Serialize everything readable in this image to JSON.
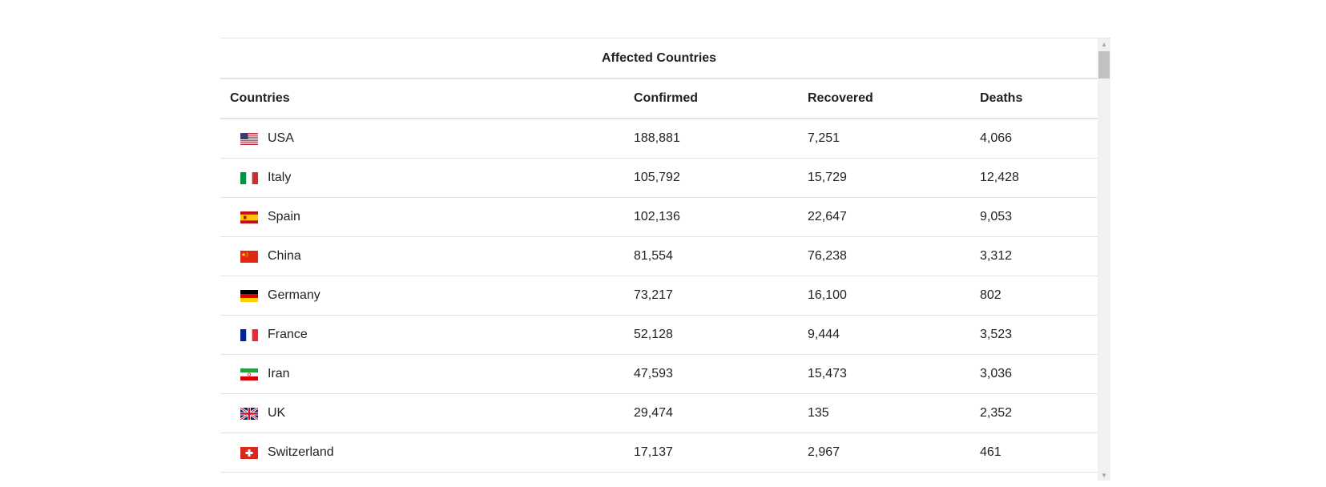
{
  "table": {
    "title": "Affected Countries",
    "headers": {
      "country": "Countries",
      "confirmed": "Confirmed",
      "recovered": "Recovered",
      "deaths": "Deaths"
    },
    "rows": [
      {
        "country": "USA",
        "flag": "us-flag-icon",
        "confirmed": "188,881",
        "recovered": "7,251",
        "deaths": "4,066"
      },
      {
        "country": "Italy",
        "flag": "italy-flag-icon",
        "confirmed": "105,792",
        "recovered": "15,729",
        "deaths": "12,428"
      },
      {
        "country": "Spain",
        "flag": "spain-flag-icon",
        "confirmed": "102,136",
        "recovered": "22,647",
        "deaths": "9,053"
      },
      {
        "country": "China",
        "flag": "china-flag-icon",
        "confirmed": "81,554",
        "recovered": "76,238",
        "deaths": "3,312"
      },
      {
        "country": "Germany",
        "flag": "germany-flag-icon",
        "confirmed": "73,217",
        "recovered": "16,100",
        "deaths": "802"
      },
      {
        "country": "France",
        "flag": "france-flag-icon",
        "confirmed": "52,128",
        "recovered": "9,444",
        "deaths": "3,523"
      },
      {
        "country": "Iran",
        "flag": "iran-flag-icon",
        "confirmed": "47,593",
        "recovered": "15,473",
        "deaths": "3,036"
      },
      {
        "country": "UK",
        "flag": "uk-flag-icon",
        "confirmed": "29,474",
        "recovered": "135",
        "deaths": "2,352"
      },
      {
        "country": "Switzerland",
        "flag": "switzerland-flag-icon",
        "confirmed": "17,137",
        "recovered": "2,967",
        "deaths": "461"
      }
    ]
  },
  "scrollbar": {
    "up_icon": "chevron-up-icon",
    "down_icon": "chevron-down-icon"
  },
  "colors": {
    "border": "#e2e2e2",
    "scroll_track": "#f1f1f1",
    "scroll_thumb": "#c1c1c1"
  }
}
